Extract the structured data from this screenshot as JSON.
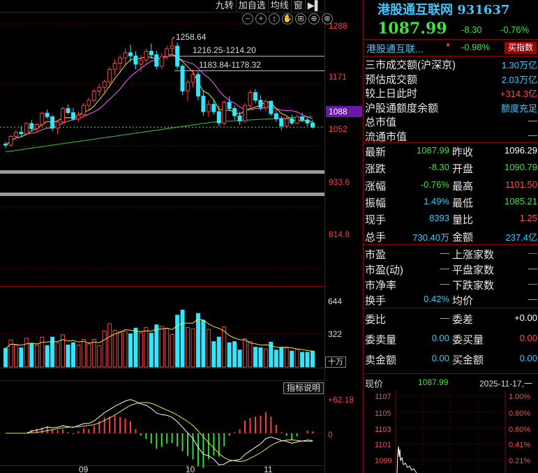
{
  "toolbar": [
    "九转",
    "加自选",
    "均线",
    "窗"
  ],
  "tool_icons": [
    "−",
    "+",
    "↕",
    "✋",
    "⊞",
    "⊕",
    "⊗"
  ],
  "price_axis": [
    "1288",
    "1171",
    "1052",
    "933.6",
    "814.8"
  ],
  "current_price_tag": "1088",
  "annotations": {
    "high": "1258.64",
    "band1": "1216.25-1214.20",
    "band2": "1183.84-1178.32"
  },
  "volume_axis": [
    "644",
    "322"
  ],
  "volume_unit": "十万",
  "indicator_button": "指标说明",
  "indicator_axis": [
    "+62.18",
    "0"
  ],
  "x_labels": [
    "09",
    "10",
    "11"
  ],
  "colors": {
    "up": "#ff4040",
    "down": "#33e6ff",
    "accent": "#3fc8ff",
    "fall": "#3ee43e"
  },
  "chart_data": {
    "type": "candlestick",
    "candles": [
      [
        1055,
        1060,
        1048,
        1053
      ],
      [
        1053,
        1072,
        1050,
        1070
      ],
      [
        1070,
        1082,
        1066,
        1078
      ],
      [
        1078,
        1090,
        1070,
        1075
      ],
      [
        1075,
        1098,
        1072,
        1095
      ],
      [
        1095,
        1102,
        1080,
        1085
      ],
      [
        1085,
        1096,
        1078,
        1093
      ],
      [
        1093,
        1118,
        1090,
        1115
      ],
      [
        1115,
        1122,
        1104,
        1108
      ],
      [
        1108,
        1112,
        1080,
        1086
      ],
      [
        1086,
        1102,
        1074,
        1098
      ],
      [
        1098,
        1128,
        1095,
        1124
      ],
      [
        1124,
        1132,
        1112,
        1116
      ],
      [
        1116,
        1125,
        1100,
        1104
      ],
      [
        1104,
        1118,
        1098,
        1112
      ],
      [
        1112,
        1135,
        1108,
        1130
      ],
      [
        1130,
        1145,
        1122,
        1140
      ],
      [
        1140,
        1162,
        1135,
        1158
      ],
      [
        1158,
        1172,
        1148,
        1165
      ],
      [
        1165,
        1180,
        1150,
        1176
      ],
      [
        1176,
        1205,
        1170,
        1200
      ],
      [
        1200,
        1220,
        1188,
        1212
      ],
      [
        1212,
        1228,
        1198,
        1222
      ],
      [
        1222,
        1240,
        1208,
        1232
      ],
      [
        1232,
        1248,
        1215,
        1226
      ],
      [
        1226,
        1235,
        1200,
        1210
      ],
      [
        1210,
        1228,
        1195,
        1218
      ],
      [
        1218,
        1240,
        1212,
        1235
      ],
      [
        1235,
        1250,
        1220,
        1228
      ],
      [
        1228,
        1236,
        1200,
        1206
      ],
      [
        1206,
        1232,
        1200,
        1225
      ],
      [
        1225,
        1246,
        1218,
        1240
      ],
      [
        1240,
        1258.64,
        1230,
        1245
      ],
      [
        1245,
        1252,
        1200,
        1206
      ],
      [
        1206,
        1210,
        1150,
        1158
      ],
      [
        1158,
        1180,
        1138,
        1175
      ],
      [
        1175,
        1200,
        1165,
        1190
      ],
      [
        1190,
        1196,
        1140,
        1148
      ],
      [
        1148,
        1160,
        1110,
        1118
      ],
      [
        1118,
        1140,
        1108,
        1132
      ],
      [
        1132,
        1142,
        1112,
        1118
      ],
      [
        1118,
        1130,
        1090,
        1096
      ],
      [
        1096,
        1140,
        1092,
        1136
      ],
      [
        1136,
        1148,
        1118,
        1124
      ],
      [
        1124,
        1130,
        1102,
        1110
      ],
      [
        1110,
        1118,
        1092,
        1100
      ],
      [
        1100,
        1135,
        1096,
        1130
      ],
      [
        1130,
        1160,
        1124,
        1155
      ],
      [
        1155,
        1162,
        1134,
        1140
      ],
      [
        1140,
        1150,
        1120,
        1126
      ],
      [
        1126,
        1142,
        1118,
        1138
      ],
      [
        1138,
        1140,
        1110,
        1114
      ],
      [
        1114,
        1122,
        1098,
        1104
      ],
      [
        1104,
        1110,
        1082,
        1090
      ],
      [
        1090,
        1108,
        1086,
        1104
      ],
      [
        1104,
        1112,
        1092,
        1096
      ],
      [
        1096,
        1112,
        1094,
        1108
      ],
      [
        1108,
        1116,
        1098,
        1102
      ],
      [
        1102,
        1106,
        1090,
        1096
      ],
      [
        1096,
        1101.5,
        1085.21,
        1087.99
      ]
    ],
    "y_range": [
      780,
      1310
    ],
    "volume_range": [
      0,
      720
    ],
    "indicator_range": [
      -60,
      75
    ]
  },
  "quote": {
    "name": "港股通互联网",
    "code": "931637",
    "price": "1087.99",
    "change": "-8.30",
    "change_pct": "-0.76%",
    "sub_name": "港股通互联...",
    "sub_pct": "-0.98%",
    "buy_index": "买指数",
    "rows_a": [
      {
        "k": "三市成交额(沪深京)",
        "v": "1.30万亿",
        "c": "cyan"
      },
      {
        "k": "预估成交额",
        "v": "2.03万亿",
        "c": "cyan"
      },
      {
        "k": "较上日此时",
        "v": "+314.3亿",
        "c": "red"
      },
      {
        "k": "沪股通额度余额",
        "v": "额度充足",
        "c": "cyan"
      },
      {
        "k": "总市值",
        "v": "—",
        "c": "gray"
      },
      {
        "k": "流通市值",
        "v": "—",
        "c": "gray"
      }
    ],
    "rows_b": [
      {
        "k1": "最新",
        "v1": "1087.99",
        "c1": "green",
        "k2": "昨收",
        "v2": "1096.29",
        "c2": "white"
      },
      {
        "k1": "涨跌",
        "v1": "-8.30",
        "c1": "green",
        "k2": "开盘",
        "v2": "1090.79",
        "c2": "green"
      },
      {
        "k1": "涨幅",
        "v1": "-0.76%",
        "c1": "green",
        "k2": "最高",
        "v2": "1101.50",
        "c2": "red"
      },
      {
        "k1": "振幅",
        "v1": "1.49%",
        "c1": "cyan",
        "k2": "最低",
        "v2": "1085.21",
        "c2": "green"
      },
      {
        "k1": "现手",
        "v1": "8393",
        "c1": "cyan",
        "k2": "量比",
        "v2": "1.25",
        "c2": "red"
      },
      {
        "k1": "总手",
        "v1": "730.40万",
        "c1": "cyan",
        "k2": "金额",
        "v2": "237.4亿",
        "c2": "cyan"
      }
    ],
    "rows_c": [
      {
        "k1": "市盈",
        "v1": "—",
        "c1": "gray",
        "k2": "上涨家数",
        "v2": "—",
        "c2": "red"
      },
      {
        "k1": "市盈(动)",
        "v1": "—",
        "c1": "gray",
        "k2": "平盘家数",
        "v2": "—",
        "c2": "gray"
      },
      {
        "k1": "市净率",
        "v1": "—",
        "c1": "gray",
        "k2": "下跌家数",
        "v2": "—",
        "c2": "green"
      },
      {
        "k1": "换手",
        "v1": "0.42%",
        "c1": "cyan",
        "k2": "均价",
        "v2": "—",
        "c2": "gray"
      }
    ],
    "rows_d": [
      {
        "k1": "委比",
        "v1": "—",
        "c1": "gray",
        "k2": "委差",
        "v2": "+0.00",
        "c2": "white"
      },
      {
        "k1": "委卖量",
        "v1": "0.00",
        "c1": "cyan",
        "k2": "委买量",
        "v2": "0.00",
        "c2": "red"
      },
      {
        "k1": "卖金额",
        "v1": "0.00",
        "c1": "cyan",
        "k2": "买金额",
        "v2": "0.00",
        "c2": "cyan"
      }
    ],
    "mini": {
      "label": "现价",
      "price": "1087.99",
      "date": "2025-11-17,一",
      "left_axis": [
        "1107",
        "1105",
        "1103",
        "1101",
        "1099"
      ],
      "right_axis": [
        "1.00%",
        "0.80%",
        "0.60%",
        "0.41%",
        "0.21%"
      ]
    }
  }
}
